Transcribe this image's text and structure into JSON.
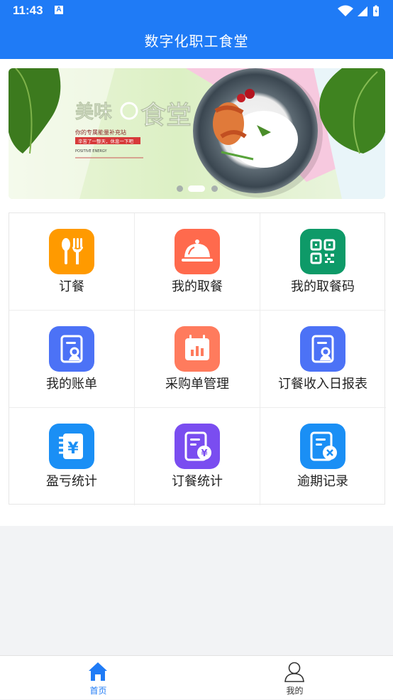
{
  "status_bar": {
    "time": "11:43",
    "notification_icon": "A"
  },
  "header": {
    "title": "数字化职工食堂"
  },
  "banner": {
    "headline": "美味",
    "headline2": "食堂",
    "tagline": "你的专属能量补充站",
    "slogan": "辛苦了一整天，休息一下吧",
    "energy": "POSITIVE ENERGY",
    "active_dot": 1,
    "dot_count": 3
  },
  "menu": [
    {
      "label": "订餐",
      "icon": "fork-spoon-icon",
      "color": "#ff9a00"
    },
    {
      "label": "我的取餐",
      "icon": "cloche-icon",
      "color": "#ff6a4d"
    },
    {
      "label": "我的取餐码",
      "icon": "qr-code-icon",
      "color": "#0e9a68"
    },
    {
      "label": "我的账单",
      "icon": "bill-icon",
      "color": "#4c72f6"
    },
    {
      "label": "采购单管理",
      "icon": "purchase-order-icon",
      "color": "#ff7b5d"
    },
    {
      "label": "订餐收入日报表",
      "icon": "daily-report-icon",
      "color": "#4c72f6"
    },
    {
      "label": "盈亏统计",
      "icon": "yuan-ledger-icon",
      "color": "#1a8ff5"
    },
    {
      "label": "订餐统计",
      "icon": "order-stats-icon",
      "color": "#7a4df0"
    },
    {
      "label": "逾期记录",
      "icon": "overdue-record-icon",
      "color": "#1a8ff5"
    }
  ],
  "tabbar": {
    "home": {
      "label": "首页",
      "color": "#1f7bf6"
    },
    "mine": {
      "label": "我的",
      "color": "#333333"
    }
  }
}
